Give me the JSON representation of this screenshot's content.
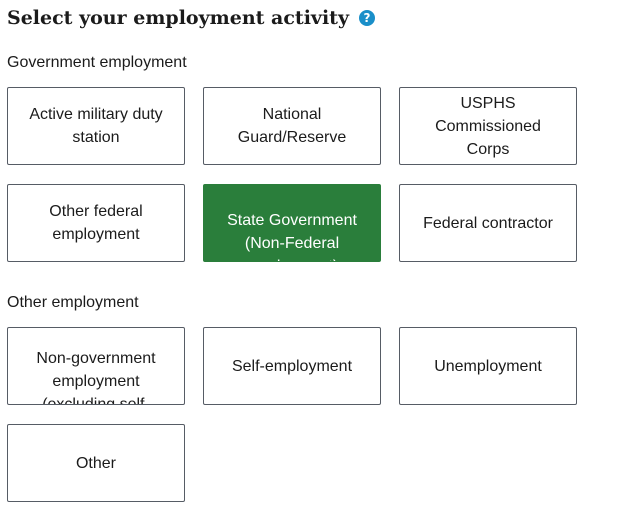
{
  "heading": {
    "title": "Select your employment activity",
    "help_icon_glyph": "?"
  },
  "groups": {
    "government": {
      "label": "Government employment",
      "options": [
        {
          "label": "Active military duty station",
          "selected": false
        },
        {
          "label": "National Guard/Reserve",
          "selected": false
        },
        {
          "label": "USPHS Commissioned Corps",
          "selected": false
        },
        {
          "label": "Other federal employment",
          "selected": false
        },
        {
          "label": "State Government (Non-Federal employment)",
          "selected": true
        },
        {
          "label": "Federal contractor",
          "selected": false
        }
      ]
    },
    "other": {
      "label": "Other employment",
      "options": [
        {
          "label": "Non-government employment (excluding self-employment)",
          "selected": false
        },
        {
          "label": "Self-employment",
          "selected": false
        },
        {
          "label": "Unemployment",
          "selected": false
        },
        {
          "label": "Other",
          "selected": false
        }
      ]
    }
  },
  "colors": {
    "selected_background": "#2a7e3b",
    "help_icon": "#1a8fc9",
    "tile_border": "#565c65"
  }
}
